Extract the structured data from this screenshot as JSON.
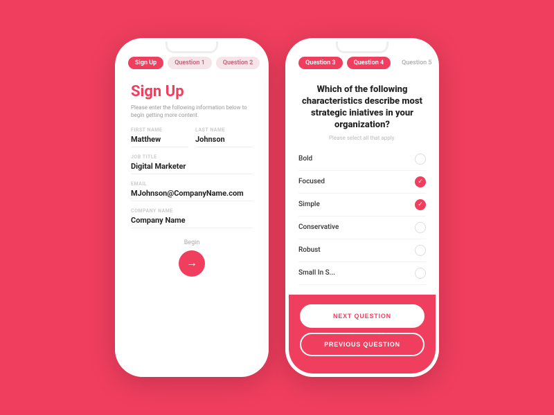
{
  "left_phone": {
    "tabs": [
      {
        "label": "Sign Up",
        "state": "active"
      },
      {
        "label": "Question 1",
        "state": "inactive"
      },
      {
        "label": "Question 2",
        "state": "inactive"
      }
    ],
    "title": "Sign Up",
    "description": "Please enter the following information below to begin getting more content.",
    "fields": {
      "first_name": {
        "label": "FIRST NAME",
        "value": "Matthew"
      },
      "last_name": {
        "label": "LAST NAME",
        "value": "Johnson"
      },
      "job_title": {
        "label": "JOB TITLE",
        "value": "Digital Marketer"
      },
      "email": {
        "label": "EMAIL",
        "value": "MJohnson@CompanyName.com"
      },
      "company_name": {
        "label": "COMPANY NAME",
        "value": "Company Name"
      }
    },
    "begin_label": "Begin",
    "begin_arrow": "→"
  },
  "right_phone": {
    "tabs": [
      {
        "label": "Question 3",
        "state": "active"
      },
      {
        "label": "Question 4",
        "state": "active"
      },
      {
        "label": "Question 5",
        "state": "plain"
      }
    ],
    "question": "Which of the following characteristics describe most strategic iniatives in your organization?",
    "subtitle": "Please select all that apply.",
    "options": [
      {
        "label": "Bold",
        "checked": false
      },
      {
        "label": "Focused",
        "checked": true
      },
      {
        "label": "Simple",
        "checked": true
      },
      {
        "label": "Conservative",
        "checked": false
      },
      {
        "label": "Robust",
        "checked": false
      },
      {
        "label": "Small In S...",
        "checked": false
      }
    ],
    "next_button": "NEXT QUESTION",
    "prev_button": "PREVIOUS QUESTION"
  }
}
